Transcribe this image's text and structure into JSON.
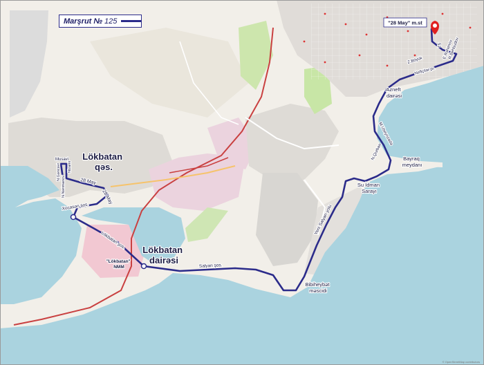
{
  "legend": {
    "title": "Marşrut №",
    "route_number": "125",
    "line_color": "#2b2b8a"
  },
  "colors": {
    "sea": "#aad3df",
    "land": "#f2efe9",
    "urban": "#e0dfdf",
    "industrial": "#ebdbe8",
    "park": "#c8e6a6",
    "route": "#2b2b8a",
    "pin": "#e02020",
    "railway": "#c94040"
  },
  "places": {
    "lokbatan_settlement": [
      "Lökbatan",
      "qəs."
    ],
    "lokbatan_circle": [
      "Lökbatan",
      "dairəsi"
    ],
    "terminus": "\"28 May\" m.st",
    "azneft": [
      "Azneft",
      "dairəsi"
    ],
    "bayraq": [
      "Bayraq",
      "meydanı"
    ],
    "su_idman": [
      "Su İdman",
      "Sarayı"
    ],
    "bibiheybat": [
      "Bibiheybət",
      "məscidi"
    ],
    "lokbatan_nmm": [
      "\"Lökbatan\"",
      "NMM"
    ]
  },
  "streets": {
    "musavi": "Musavi",
    "n_gencevi": "N.Gəncəvi",
    "nizami": "Nizami",
    "n_narimanov": "N.Nərimanov",
    "may28_west": "28 May",
    "may28_diag": "28 May",
    "xocasen": "Xocasən şos.",
    "lokbatan_sos": "Lökbatan şos.",
    "salyan_sos": "Salyan şos.",
    "yeni_salyan": "Yeni Salyan yolu",
    "n_qurban": "N.Qurban",
    "m_useynzade": "M.Useynzadə",
    "neftciler": "Neftçilər pr.",
    "z_boyuk": "Z.Böyük",
    "r_behbudov": "R.Behbudov",
    "e_ragimov": "E.Rəhimov",
    "short_51": "51"
  },
  "credit": "© OpenStreetMap contributors"
}
